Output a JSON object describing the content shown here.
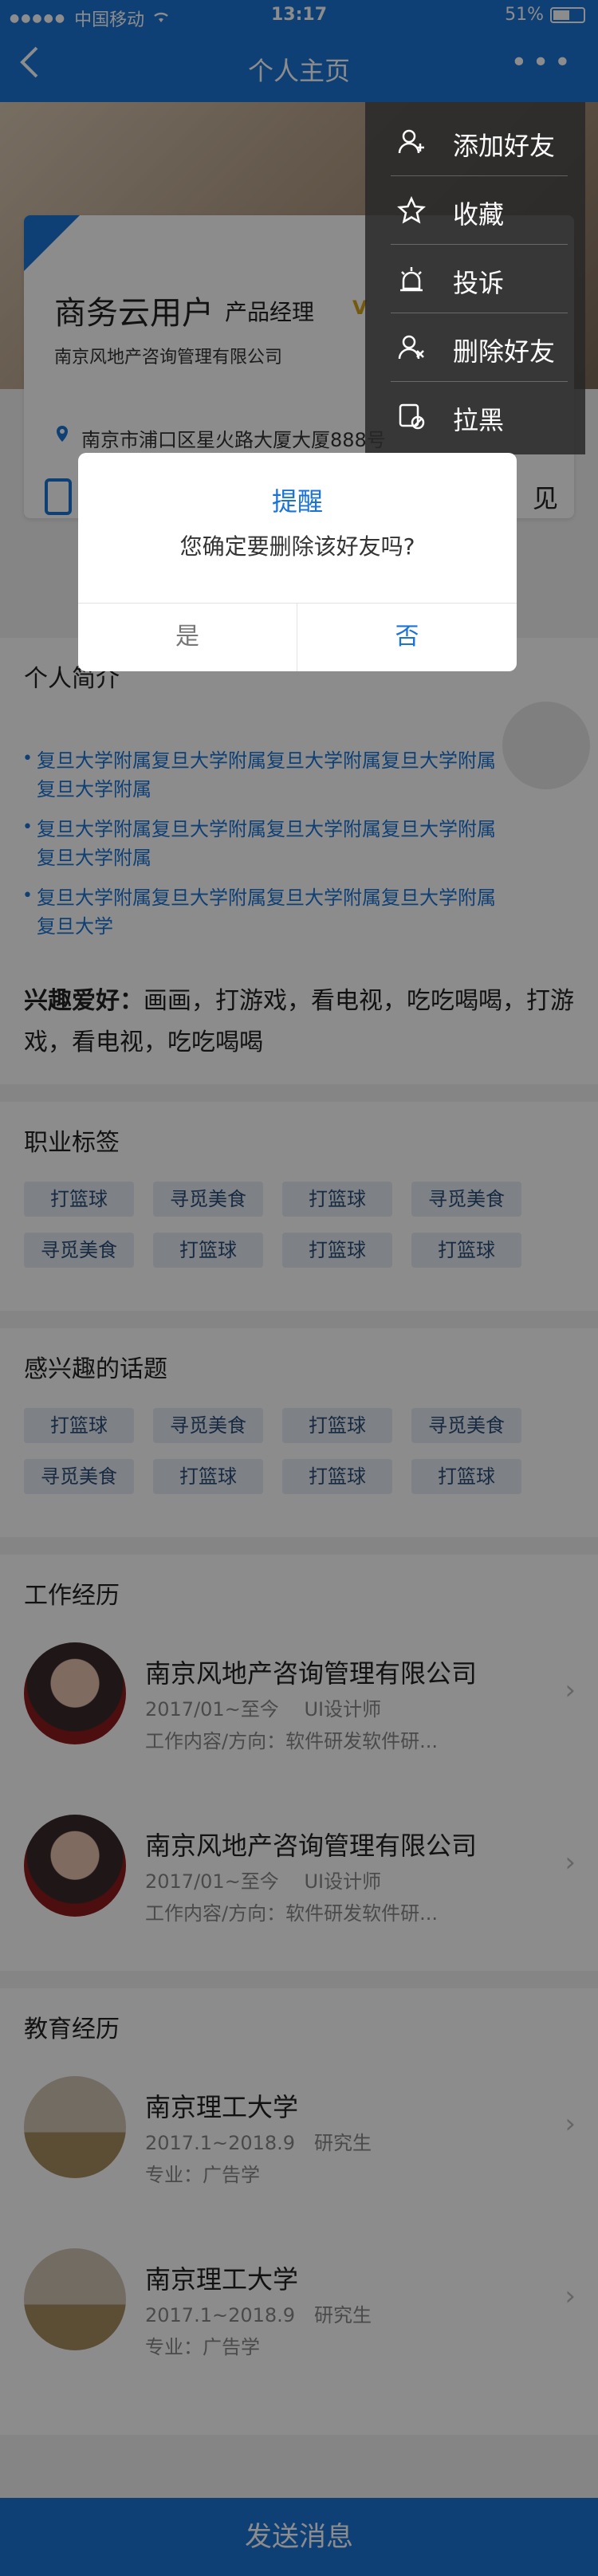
{
  "status_bar": {
    "carrier": "中国移动",
    "time": "13:17",
    "battery": "51%"
  },
  "nav": {
    "title": "个人主页"
  },
  "profile": {
    "name": "商务云用户",
    "role": "产品经理",
    "badge": "V",
    "company": "南京风地产咨询管理有限公司",
    "address": "南京市浦口区星火路大厦大厦888号",
    "action_right": "见"
  },
  "intro": {
    "title": "个人简介",
    "bullets": [
      "复旦大学附属复旦大学附属复旦大学附属复旦大学附属复旦大学附属",
      "复旦大学附属复旦大学附属复旦大学附属复旦大学附属复旦大学附属",
      "复旦大学附属复旦大学附属复旦大学附属复旦大学附属复旦大学"
    ],
    "hobby_label": "兴趣爱好：",
    "hobby_text": "画画，打游戏，看电视，吃吃喝喝，打游戏，看电视，吃吃喝喝"
  },
  "career_tags": {
    "title": "职业标签",
    "tags": [
      "打篮球",
      "寻觅美食",
      "打篮球",
      "寻觅美食",
      "寻觅美食",
      "打篮球",
      "打篮球",
      "打篮球"
    ]
  },
  "topics": {
    "title": "感兴趣的话题",
    "tags": [
      "打篮球",
      "寻觅美食",
      "打篮球",
      "寻觅美食",
      "寻觅美食",
      "打篮球",
      "打篮球",
      "打篮球"
    ]
  },
  "work": {
    "title": "工作经历",
    "items": [
      {
        "company": "南京风地产咨询管理有限公司",
        "period": "2017/01~至今　 UI设计师",
        "desc": "工作内容/方向：软件研发软件研..."
      },
      {
        "company": "南京风地产咨询管理有限公司",
        "period": "2017/01~至今　 UI设计师",
        "desc": "工作内容/方向：软件研发软件研..."
      }
    ]
  },
  "education": {
    "title": "教育经历",
    "items": [
      {
        "school": "南京理工大学",
        "period": "2017.1~2018.9　研究生",
        "major": "专业：广告学"
      },
      {
        "school": "南京理工大学",
        "period": "2017.1~2018.9　研究生",
        "major": "专业：广告学"
      }
    ]
  },
  "send_button": "发送消息",
  "menu": {
    "items": [
      {
        "label": "添加好友",
        "icon": "add-user-icon"
      },
      {
        "label": "收藏",
        "icon": "star-icon"
      },
      {
        "label": "投诉",
        "icon": "alarm-icon"
      },
      {
        "label": "删除好友",
        "icon": "remove-user-icon"
      },
      {
        "label": "拉黑",
        "icon": "block-icon"
      }
    ]
  },
  "dialog": {
    "title": "提醒",
    "message": "您确定要删除该好友吗?",
    "yes": "是",
    "no": "否"
  },
  "colors": {
    "primary": "#1a74d6",
    "tag_bg": "#e6ecf3"
  }
}
